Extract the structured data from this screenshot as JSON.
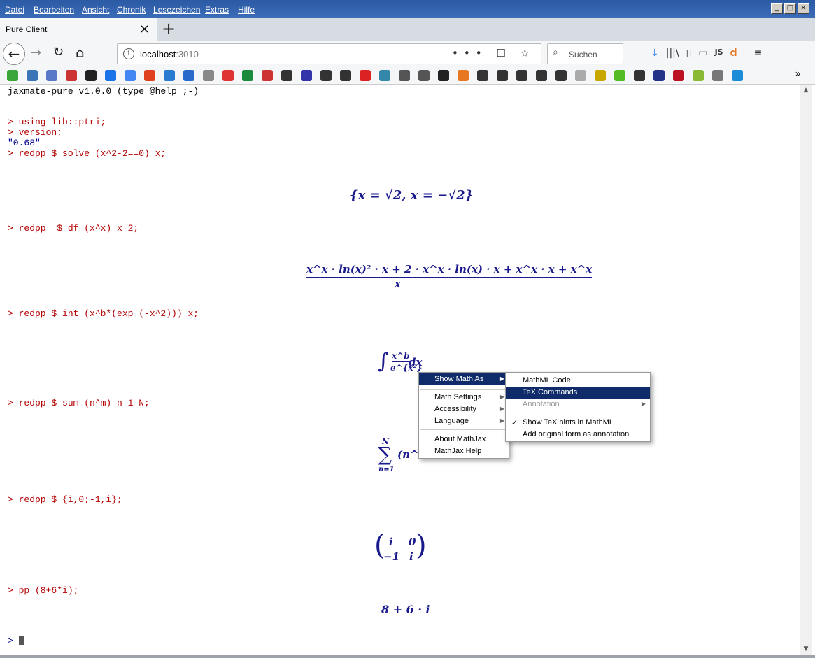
{
  "menubar": {
    "items": [
      "Datei",
      "Bearbeiten",
      "Ansicht",
      "Chronik",
      "Lesezeichen",
      "Extras",
      "Hilfe"
    ],
    "window_buttons": [
      "_",
      "□",
      "×"
    ]
  },
  "tab": {
    "title": "Pure Client",
    "close": "×",
    "new_tab": "+"
  },
  "nav": {
    "back": "←",
    "forward": "→",
    "reload": "↻",
    "home": "⌂",
    "url_host": "localhost",
    "url_port": ":3010",
    "url_actions": "••• ☐ ☆",
    "search_placeholder": "Suchen",
    "search_icon": "magnifier-icon",
    "tools": [
      "↓",
      "|||\\",
      "▯",
      "▭",
      "JS",
      "d",
      "≡"
    ]
  },
  "bookmarks_colors": [
    "#3aa63a",
    "#3b75b8",
    "#5a78c8",
    "#c33",
    "#222",
    "#1a73e8",
    "#4285f4",
    "#e04020",
    "#2a7ad0",
    "#2a6acb",
    "#888",
    "#d33",
    "#1b8a3a",
    "#c33",
    "#333",
    "#33a",
    "#333",
    "#333",
    "#d22",
    "#38a",
    "#555",
    "#555",
    "#222",
    "#e87722",
    "#333",
    "#333",
    "#333",
    "#333",
    "#333",
    "#aaa",
    "#c8a800",
    "#5b2",
    "#333",
    "#238",
    "#b12",
    "#8b3",
    "#777",
    "#1a8cd8"
  ],
  "console": {
    "header": "jaxmate-pure v1.0.0 (type @help ;-)",
    "lines": [
      {
        "text": "> using lib::ptri;",
        "color": "red"
      },
      {
        "text": "> version;",
        "color": "red"
      },
      {
        "text": "\"0.68\"",
        "color": "blue"
      },
      {
        "text": "> redpp $ solve (x^2-2==0) x;",
        "color": "red"
      },
      {
        "text": "> redpp  $ df (x^x) x 2;",
        "color": "red"
      },
      {
        "text": "> redpp $ int (x^b*(exp (-x^2))) x;",
        "color": "red"
      },
      {
        "text": "> redpp $ sum (n^m) n 1 N;",
        "color": "red"
      },
      {
        "text": "> redpp $ {i,0;-1,i};",
        "color": "red"
      },
      {
        "text": "> pp (8+6*i);",
        "color": "red"
      },
      {
        "text": ">",
        "color": "blue"
      }
    ]
  },
  "math": {
    "solve": "{x = √2, x = −√2}",
    "df_num": "x^x · ln(x)² · x + 2 · x^x · ln(x) · x + x^x · x + x^x",
    "df_den": "x",
    "int_sign": "∫",
    "int_num": "x^b",
    "int_den": "e^{x²}",
    "int_dx": "dx",
    "sum_upper": "N",
    "sum_sign": "∑",
    "sum_lower": "n=1",
    "sum_body": "(n^m)",
    "matrix": [
      "i",
      "0",
      "−1",
      "i"
    ],
    "complex": "8 + 6 · i"
  },
  "context_menu": {
    "items": [
      {
        "label": "Show Math As",
        "submenu": true,
        "selected": true
      },
      {
        "label": "Math Settings",
        "submenu": true
      },
      {
        "label": "Accessibility",
        "submenu": true
      },
      {
        "label": "Language",
        "submenu": true
      },
      {
        "label": "About MathJax"
      },
      {
        "label": "MathJax Help"
      }
    ]
  },
  "submenu": {
    "items": [
      {
        "label": "MathML Code"
      },
      {
        "label": "TeX Commands",
        "selected": true
      },
      {
        "label": "Annotation",
        "disabled": true,
        "submenu": true
      },
      {
        "label": "Show TeX hints in MathML",
        "checked": true
      },
      {
        "label": "Add original form as annotation"
      }
    ],
    "check": "✓"
  }
}
